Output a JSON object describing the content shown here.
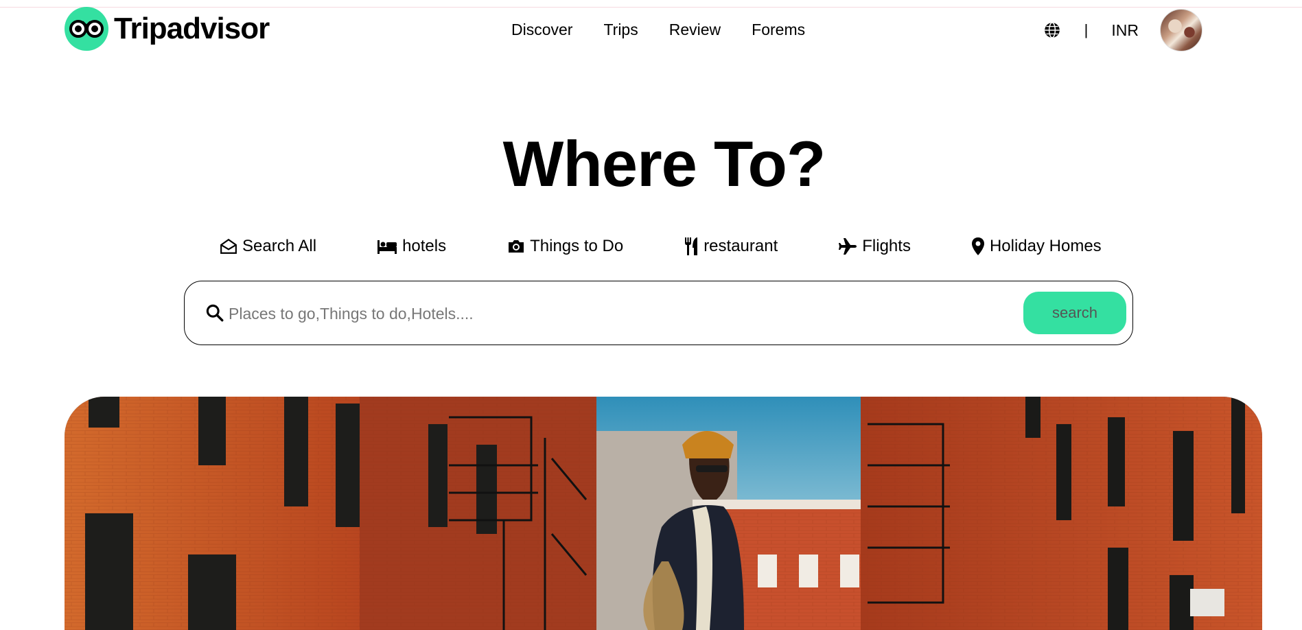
{
  "header": {
    "brand": "Tripadvisor",
    "nav": [
      {
        "label": "Discover"
      },
      {
        "label": "Trips"
      },
      {
        "label": "Review"
      },
      {
        "label": "Forems"
      }
    ],
    "separator": "|",
    "currency": "INR"
  },
  "hero": {
    "title": "Where To?"
  },
  "categories": [
    {
      "label": "Search All",
      "icon": "envelope-open-icon"
    },
    {
      "label": "hotels",
      "icon": "bed-icon"
    },
    {
      "label": "Things to Do",
      "icon": "camera-icon"
    },
    {
      "label": "restaurant",
      "icon": "utensils-icon"
    },
    {
      "label": "Flights",
      "icon": "plane-icon"
    },
    {
      "label": "Holiday Homes",
      "icon": "map-pin-icon"
    }
  ],
  "search": {
    "placeholder": "Places to go,Things to do,Hotels....",
    "value": "",
    "button_label": "search"
  },
  "colors": {
    "brand_green": "#34e0a1",
    "text": "#000000"
  }
}
